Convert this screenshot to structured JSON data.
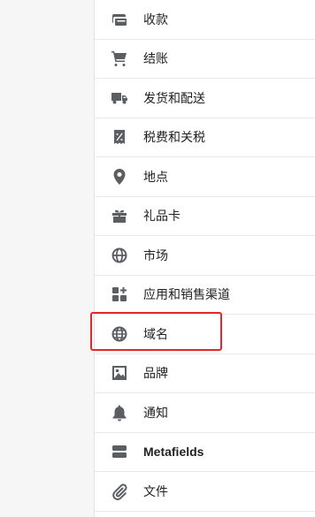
{
  "menu": {
    "items": [
      {
        "label": "收款",
        "icon": "payment-icon"
      },
      {
        "label": "结账",
        "icon": "cart-icon"
      },
      {
        "label": "发货和配送",
        "icon": "truck-icon"
      },
      {
        "label": "税费和关税",
        "icon": "tax-receipt-icon"
      },
      {
        "label": "地点",
        "icon": "location-pin-icon"
      },
      {
        "label": "礼品卡",
        "icon": "gift-icon"
      },
      {
        "label": "市场",
        "icon": "globe-market-icon"
      },
      {
        "label": "应用和销售渠道",
        "icon": "apps-icon"
      },
      {
        "label": "域名",
        "icon": "globe-domain-icon"
      },
      {
        "label": "品牌",
        "icon": "brand-image-icon"
      },
      {
        "label": "通知",
        "icon": "bell-icon"
      },
      {
        "label": "Metafields",
        "icon": "metafields-icon"
      },
      {
        "label": "文件",
        "icon": "paperclip-icon"
      }
    ],
    "highlighted_item": "域名"
  },
  "colors": {
    "icon": "#5c5f62",
    "text": "#202223",
    "highlight": "#e8262a",
    "divider": "#e9eaec",
    "background": "#f6f6f7"
  }
}
